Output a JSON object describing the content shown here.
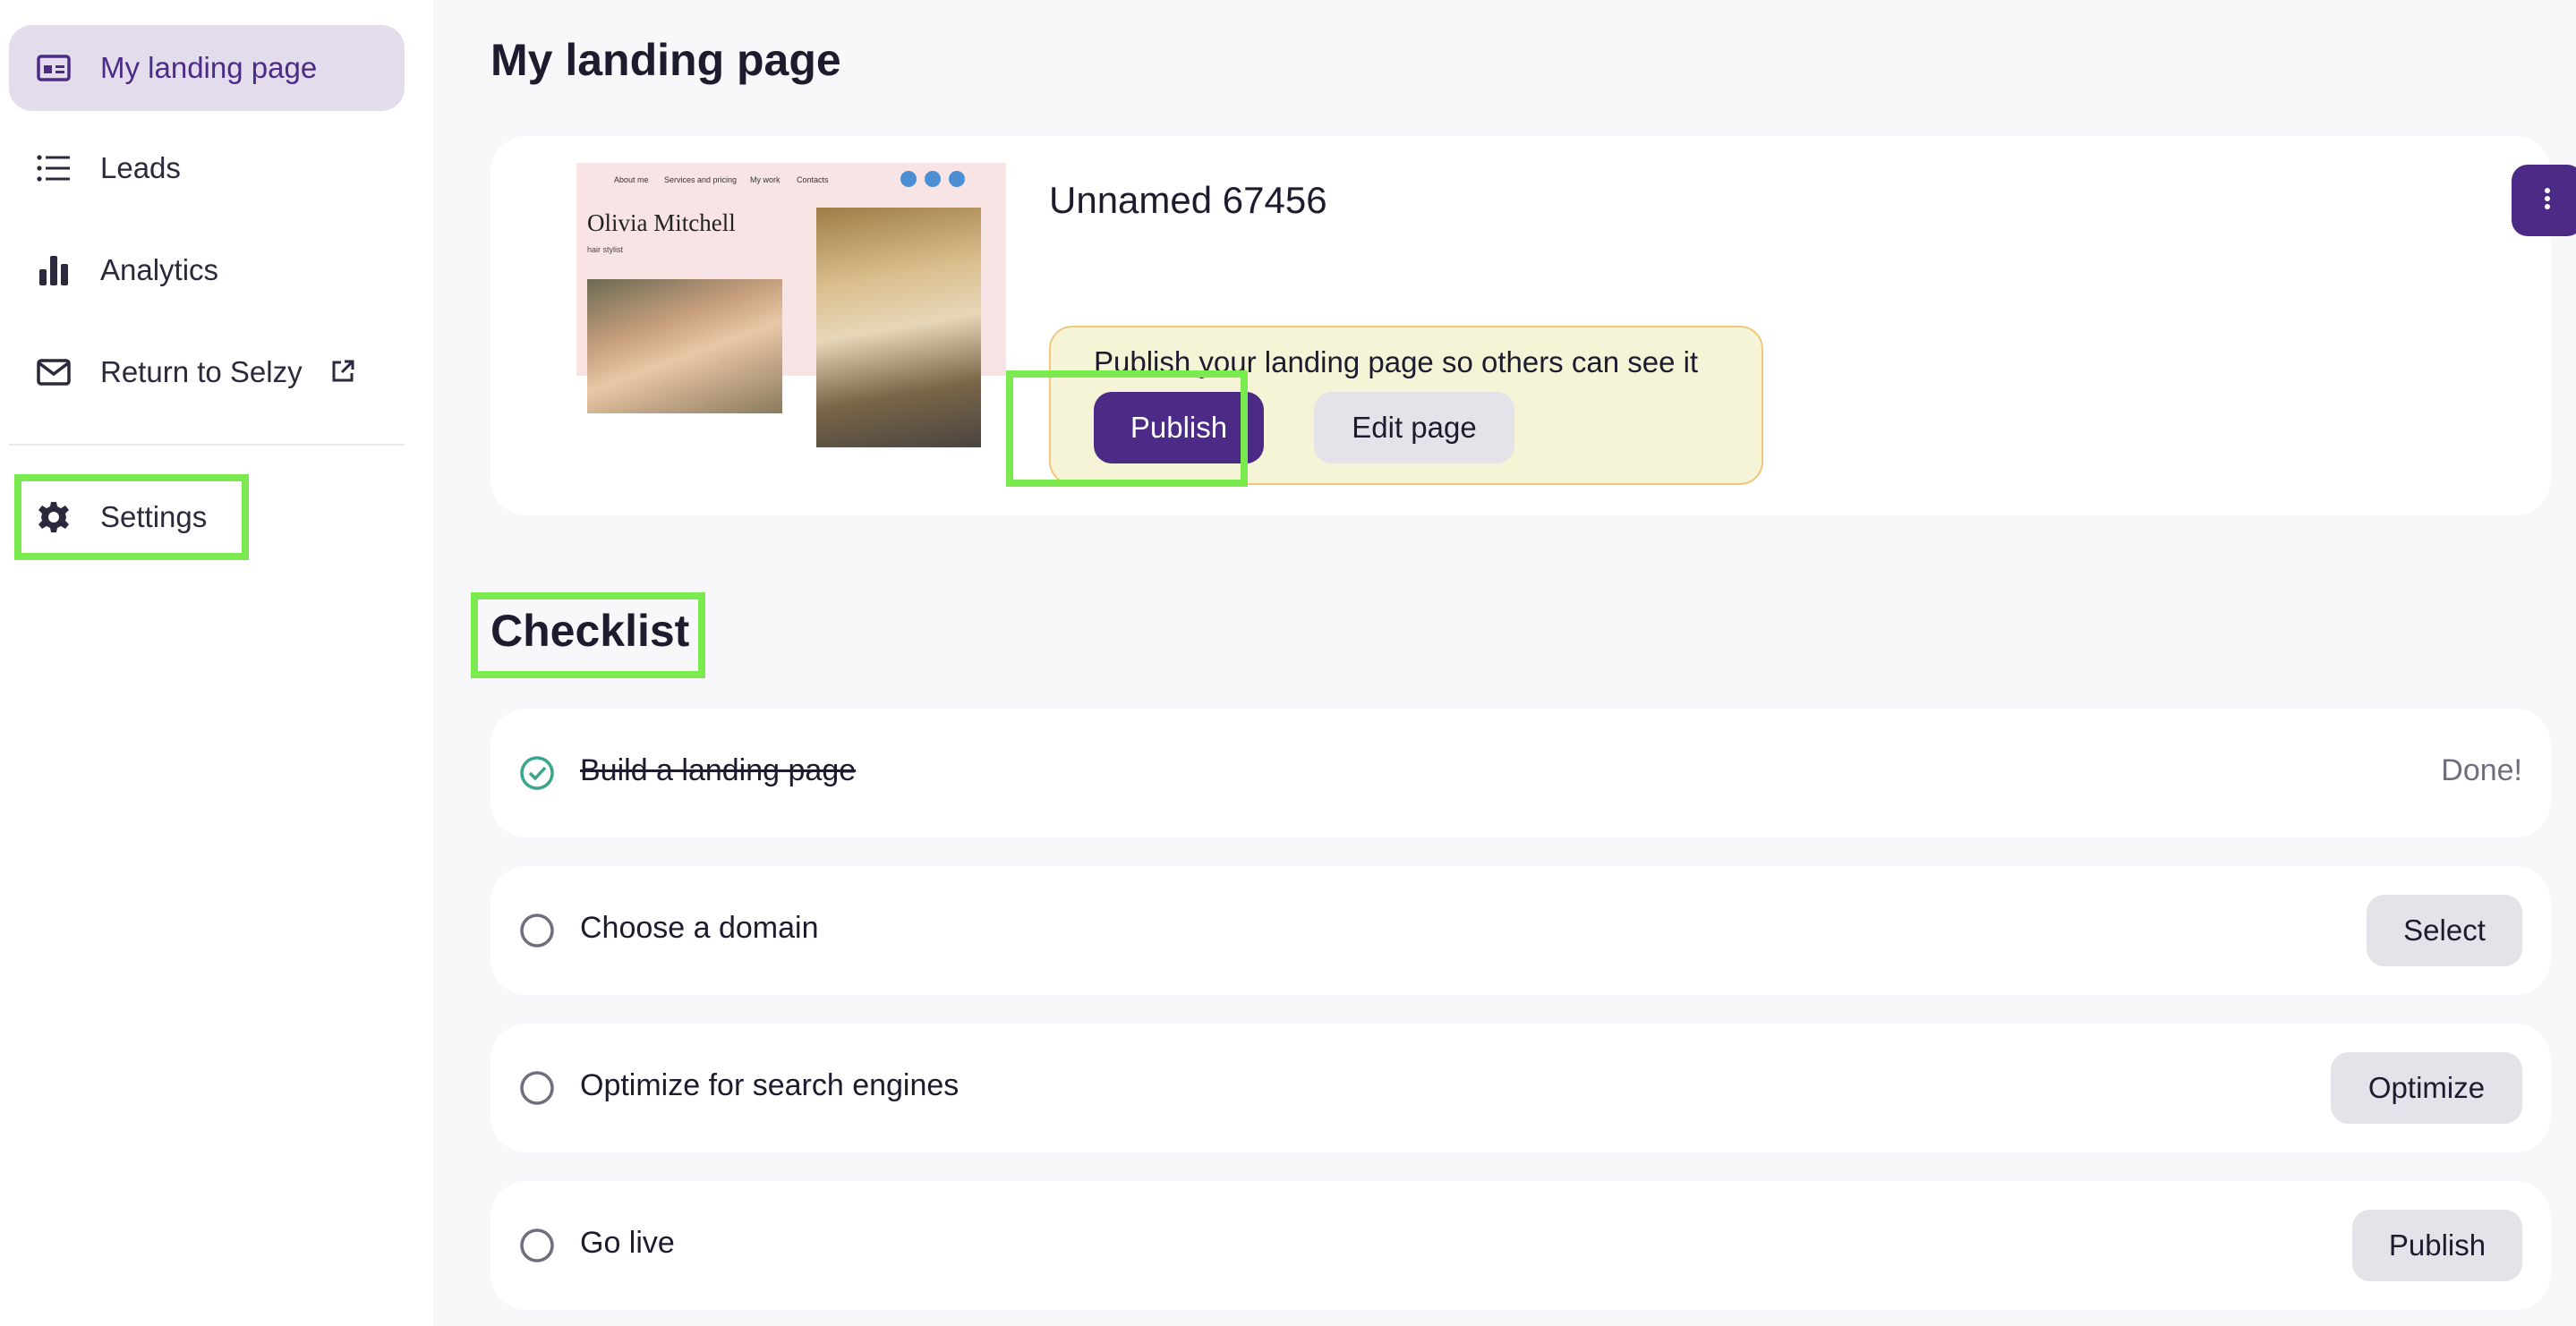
{
  "sidebar": {
    "items": [
      {
        "label": "My landing page",
        "icon": "landing-page-icon",
        "active": true
      },
      {
        "label": "Leads",
        "icon": "list-icon"
      },
      {
        "label": "Analytics",
        "icon": "bar-chart-icon"
      },
      {
        "label": "Return to Selzy",
        "icon": "mail-icon",
        "external_icon": "external-link-icon"
      }
    ],
    "settings_label": "Settings"
  },
  "main": {
    "title": "My landing page",
    "card": {
      "page_name": "Unnamed 67456",
      "thumbnail": {
        "nav": [
          "About me",
          "Services and pricing",
          "My work",
          "Contacts"
        ],
        "name": "Olivia Mitchell",
        "subtitle": "hair stylist"
      },
      "notice_text": "Publish your landing page so others can see it",
      "publish_label": "Publish",
      "edit_label": "Edit page"
    },
    "checklist_title": "Checklist",
    "checklist": [
      {
        "label": "Build a landing page",
        "done": true,
        "status": "Done!"
      },
      {
        "label": "Choose a domain",
        "done": false,
        "action": "Select"
      },
      {
        "label": "Optimize for search engines",
        "done": false,
        "action": "Optimize"
      },
      {
        "label": "Go live",
        "done": false,
        "action": "Publish"
      }
    ]
  },
  "colors": {
    "accent": "#4b2b86",
    "active_bg": "#e3dcec",
    "highlight": "#7aea4f",
    "done_check": "#3aa58a",
    "notice_bg": "#f6f4d6",
    "notice_border": "#f0c77a"
  }
}
